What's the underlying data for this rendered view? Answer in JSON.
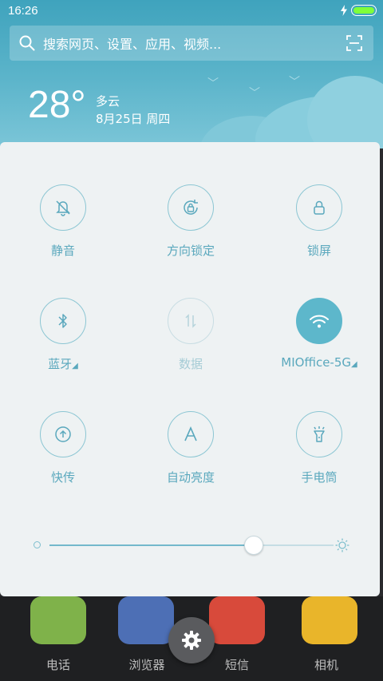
{
  "status": {
    "time": "16:26"
  },
  "search": {
    "placeholder": "搜索网页、设置、应用、视频..."
  },
  "weather": {
    "temperature": "28°",
    "condition": "多云",
    "date": "8月25日 周四"
  },
  "toggles": [
    {
      "label": "静音",
      "icon": "bell-mute-icon",
      "state": "off"
    },
    {
      "label": "方向锁定",
      "icon": "rotation-lock-icon",
      "state": "off"
    },
    {
      "label": "锁屏",
      "icon": "lock-icon",
      "state": "off"
    },
    {
      "label": "蓝牙",
      "icon": "bluetooth-icon",
      "state": "off",
      "has_dropdown": true
    },
    {
      "label": "数据",
      "icon": "mobile-data-icon",
      "state": "disabled"
    },
    {
      "label": "MIOffice-5G",
      "icon": "wifi-icon",
      "state": "on",
      "has_dropdown": true
    },
    {
      "label": "快传",
      "icon": "upload-icon",
      "state": "off"
    },
    {
      "label": "自动亮度",
      "icon": "auto-brightness-icon",
      "state": "off"
    },
    {
      "label": "手电筒",
      "icon": "flashlight-icon",
      "state": "off"
    }
  ],
  "brightness": {
    "level": 0.72
  },
  "dock": {
    "apps": [
      "电话",
      "浏览器",
      "短信",
      "相机"
    ]
  },
  "colors": {
    "accent": "#5db7cb",
    "header": "#4faec6",
    "panel": "#eef2f3"
  }
}
